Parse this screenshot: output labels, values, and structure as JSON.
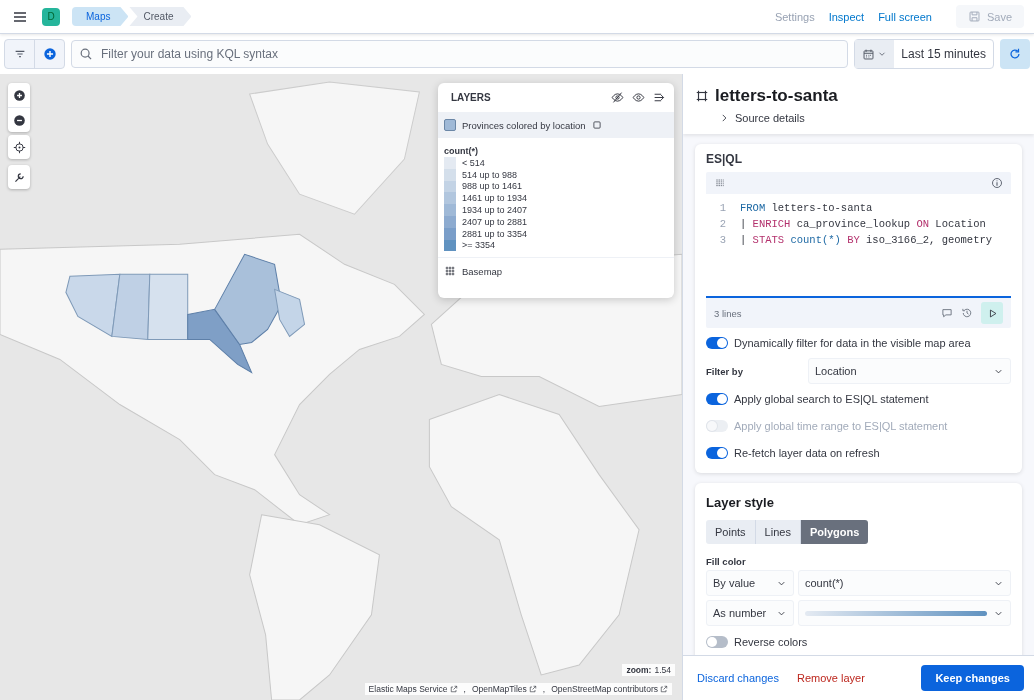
{
  "header": {
    "avatar": "D",
    "breadcrumbs": [
      {
        "label": "Maps",
        "selected": true
      },
      {
        "label": "Create",
        "selected": false
      }
    ],
    "links": [
      {
        "label": "Settings",
        "disabled": true
      },
      {
        "label": "Inspect",
        "disabled": false
      },
      {
        "label": "Full screen",
        "disabled": false
      }
    ],
    "save": {
      "label": "Save",
      "disabled": true
    }
  },
  "query_bar": {
    "placeholder": "Filter your data using KQL syntax",
    "time_range": "Last 15 minutes"
  },
  "map": {
    "layers_panel": {
      "title": "LAYERS",
      "layers": [
        {
          "name": "Provinces colored by location",
          "selected": true,
          "legend_title": "count(*)",
          "legend": [
            {
              "label": "< 514",
              "color": "#e4eaf2"
            },
            {
              "label": "514 up to 988",
              "color": "#d4dfeb"
            },
            {
              "label": "988 up to 1461",
              "color": "#c3d3e5"
            },
            {
              "label": "1461 up to 1934",
              "color": "#b1c6de"
            },
            {
              "label": "1934 up to 2407",
              "color": "#9fb9d7"
            },
            {
              "label": "2407 up to 2881",
              "color": "#8dabd0"
            },
            {
              "label": "2881 up to 3354",
              "color": "#7a9ec9"
            },
            {
              "label": ">= 3354",
              "color": "#6092c0"
            }
          ]
        },
        {
          "name": "Basemap",
          "selected": false
        }
      ]
    },
    "zoom_label": "zoom:",
    "zoom_value": "1.54",
    "attribution": [
      {
        "label": "Elastic Maps Service",
        "separator": ","
      },
      {
        "label": "OpenMapTiles",
        "separator": ","
      },
      {
        "label": "OpenStreetMap contributors"
      }
    ]
  },
  "editor": {
    "title": "letters-to-santa",
    "source_details": "Source details",
    "query_heading": "ES|QL",
    "code": [
      {
        "number": "1",
        "tokens": [
          {
            "text": "FROM",
            "kind": "source"
          },
          {
            "text": " letters-to-santa",
            "kind": "plain"
          }
        ]
      },
      {
        "number": "2",
        "tokens": [
          {
            "text": "| ",
            "kind": "plain"
          },
          {
            "text": "ENRICH",
            "kind": "keyword"
          },
          {
            "text": " ca_province_lookup ",
            "kind": "plain"
          },
          {
            "text": "ON",
            "kind": "keyword"
          },
          {
            "text": " Location",
            "kind": "plain"
          }
        ]
      },
      {
        "number": "3",
        "tokens": [
          {
            "text": "| ",
            "kind": "plain"
          },
          {
            "text": "STATS",
            "kind": "keyword"
          },
          {
            "text": " count(*)",
            "kind": "function"
          },
          {
            "text": " BY",
            "kind": "keyword"
          },
          {
            "text": " iso_3166_2, geometry",
            "kind": "plain"
          }
        ]
      }
    ],
    "line_count": "3 lines",
    "options": [
      {
        "kind": "switch",
        "label": "Dynamically filter for data in the visible map area",
        "on": true,
        "disabled": false
      },
      {
        "kind": "select",
        "label": "Filter by",
        "value": "Location"
      },
      {
        "kind": "switch",
        "label": "Apply global search to ES|QL statement",
        "on": true,
        "disabled": false
      },
      {
        "kind": "switch",
        "label": "Apply global time range to ES|QL statement",
        "on": false,
        "disabled": true
      },
      {
        "kind": "switch",
        "label": "Re-fetch layer data on refresh",
        "on": true,
        "disabled": false
      }
    ],
    "style": {
      "title": "Layer style",
      "tabs": [
        {
          "label": "Points",
          "selected": false
        },
        {
          "label": "Lines",
          "selected": false
        },
        {
          "label": "Polygons",
          "selected": true
        }
      ],
      "fill_label": "Fill color",
      "fill_type": "By value",
      "field": "count(*)",
      "scale": "As number",
      "reverse": {
        "label": "Reverse colors",
        "on": false
      }
    },
    "footer": [
      {
        "label": "Discard changes",
        "kind": "link"
      },
      {
        "label": "Remove layer",
        "kind": "danger"
      },
      {
        "label": "Keep changes",
        "kind": "primary"
      }
    ]
  }
}
